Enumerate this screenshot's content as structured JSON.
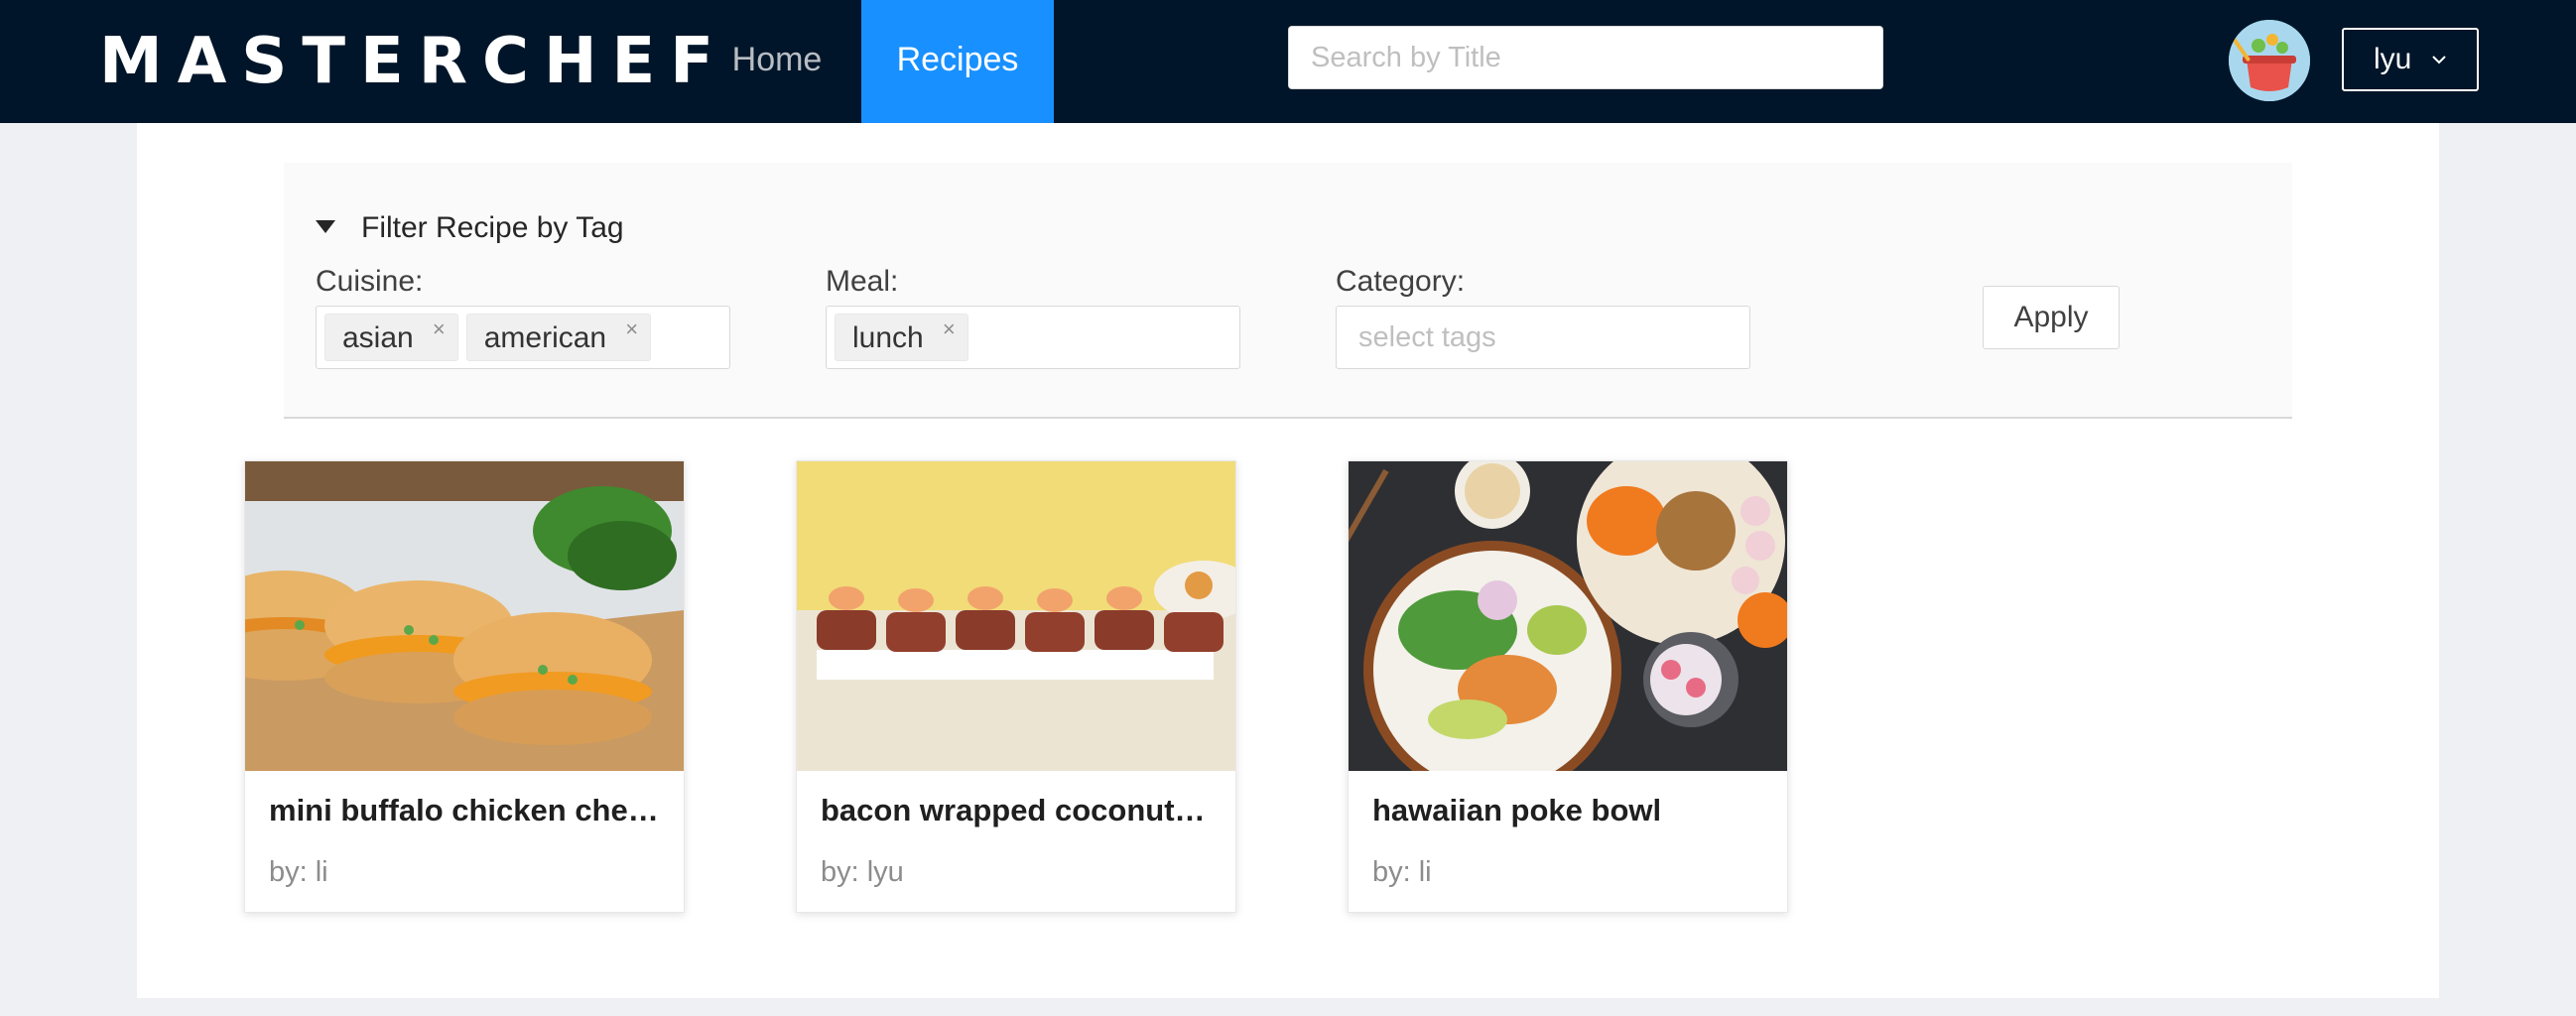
{
  "brand": "MASTERCHEF",
  "nav": {
    "home": "Home",
    "recipes": "Recipes"
  },
  "search": {
    "placeholder": "Search by Title",
    "value": ""
  },
  "user": {
    "name": "lyu"
  },
  "filter": {
    "header": "Filter Recipe by Tag",
    "cuisine": {
      "label": "Cuisine:",
      "tags": [
        "asian",
        "american"
      ]
    },
    "meal": {
      "label": "Meal:",
      "tags": [
        "lunch"
      ]
    },
    "category": {
      "label": "Category:",
      "placeholder": "select tags"
    },
    "apply": "Apply"
  },
  "recipes": [
    {
      "title": "mini buffalo chicken cheesesteak sliders",
      "author": "by: li"
    },
    {
      "title": "bacon wrapped coconut qu",
      "author": "by: lyu"
    },
    {
      "title": "hawaiian poke bowl",
      "author": "by: li"
    }
  ],
  "colors": {
    "navbar": "#001529",
    "active_tab": "#1890ff",
    "page_bg": "#eff0f4"
  }
}
